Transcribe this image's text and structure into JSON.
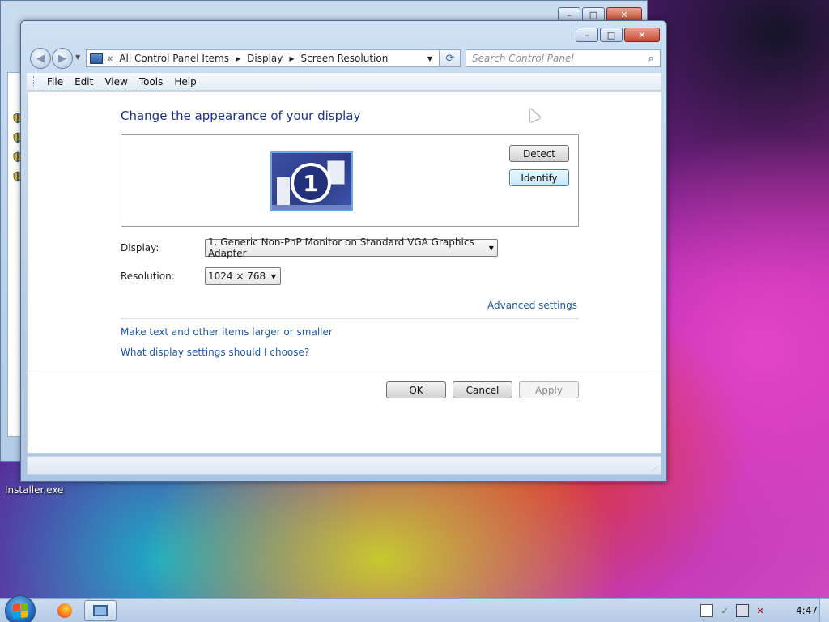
{
  "desktop": {
    "icon_label": "Installer.exe"
  },
  "window": {
    "address": {
      "chevron": "«",
      "crumbs": [
        "All Control Panel Items",
        "Display",
        "Screen Resolution"
      ]
    },
    "search": {
      "placeholder": "Search Control Panel"
    },
    "menu": {
      "file": "File",
      "edit": "Edit",
      "view": "View",
      "tools": "Tools",
      "help": "Help"
    },
    "content": {
      "title": "Change the appearance of your display",
      "monitor_number": "1",
      "detect_button": "Detect",
      "identify_button": "Identify",
      "display_label": "Display:",
      "display_value": "1. Generic Non-PnP Monitor on Standard VGA Graphics Adapter",
      "resolution_label": "Resolution:",
      "resolution_value": "1024 × 768",
      "advanced_link": "Advanced settings",
      "text_size_link": "Make text and other items larger or smaller",
      "help_link": "What display settings should I choose?",
      "ok_button": "OK",
      "cancel_button": "Cancel",
      "apply_button": "Apply"
    }
  },
  "taskbar": {
    "clock": "4:47"
  },
  "icons": {
    "start": "windows-logo-icon",
    "firefox": "firefox-icon",
    "display": "display-settings-icon",
    "tray": [
      "action-center-icon",
      "security-shield-icon",
      "network-icon",
      "volume-muted-icon"
    ]
  },
  "colors": {
    "title_text": "#1e3287",
    "link_text": "#1f57a5"
  }
}
